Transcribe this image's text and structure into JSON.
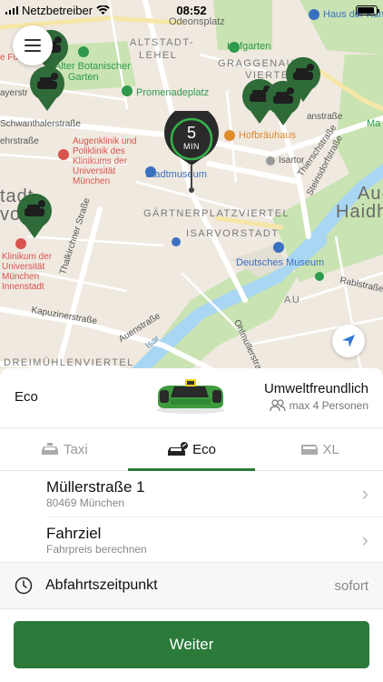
{
  "status_bar": {
    "carrier": "Netzbetreiber",
    "time": "08:52"
  },
  "map": {
    "labels": {
      "odeonsplatz": "Odeonsplatz",
      "haus_der_kunst": "Haus der Kunst",
      "altstadt_lehel": "ALTSTADT-",
      "altstadt_lehel2": "LEHEL",
      "hofgarten": "Hofgarten",
      "graggenau": "GRAGGENAU",
      "viertel": "VIERTEL",
      "botanischer": "Alter Botanischer",
      "garten": "Garten",
      "promenadeplatz": "Promenadeplatz",
      "hofbraeuhaus": "Hofbräuhaus",
      "augenklinik": "Augenklinik und\nPoliklinik des\nKlinikums der\nUniversität\nMünchen",
      "stadtmuseum": "Stadtmuseum",
      "isartor": "Isartor",
      "gaertnerplatz": "GÄRTNERPLATZVIERTEL",
      "isarvorstadt": "ISARVORSTADT",
      "deutsches_museum": "Deutsches Museum",
      "au": "AU",
      "au_haidh": "Au-",
      "au_haidh2": "Haidh",
      "klinikum": "Klinikum der\nUniversität\nMünchen\nInnenstadt",
      "schwanthaler": "Schwanthalerstraße",
      "thalkirchner": "Thalkirchner Straße",
      "kapuziner": "Kapuzinerstraße",
      "auenstrasse": "Auenstraße",
      "ohlmueller": "Ohlmüllerstraße",
      "dreimuehlen": "DREIMÜHLENVIERTEL",
      "steinsdorf": "Steinsdorfstraße",
      "thiersch": "Thierschstraße",
      "zweibruecken": "anstraße",
      "rablstrasse": "Rablstraße",
      "isar": "Isar",
      "stadt": "tadt",
      "vorstadt": "vorst",
      "eh": "ehrstraße",
      "ayer": "ayerstr",
      "ef": "e Fü",
      "ma": "Ma"
    },
    "eta": {
      "value": "5",
      "unit": "MIN"
    }
  },
  "sheet": {
    "car_name": "Eco",
    "car_tagline": "Umweltfreundlich",
    "capacity": "max 4 Personen",
    "tabs": [
      {
        "label": "Taxi"
      },
      {
        "label": "Eco"
      },
      {
        "label": "XL"
      }
    ],
    "pickup": {
      "title": "Müllerstraße 1",
      "subtitle": "80469 München"
    },
    "destination": {
      "title": "Fahrziel",
      "subtitle": "Fahrpreis berechnen"
    },
    "departure": {
      "label": "Abfahrtszeitpunkt",
      "value": "sofort"
    },
    "cta_label": "Weiter"
  },
  "colors": {
    "brand_green": "#2b7a3a",
    "pin_green": "#2e6b38"
  }
}
